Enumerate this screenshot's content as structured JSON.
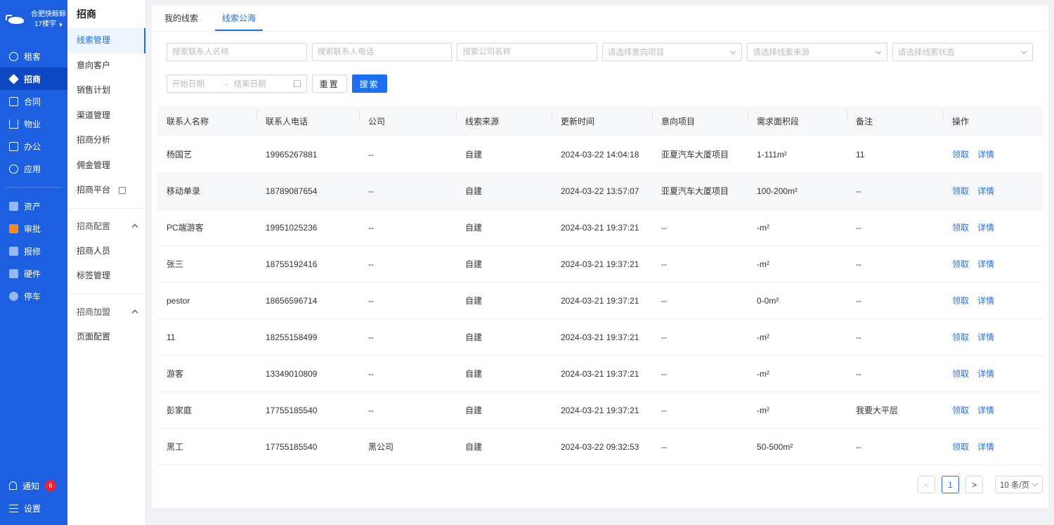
{
  "rail": {
    "brand_line1": "合肥快鲸鲸",
    "brand_line2": "17楼宇",
    "items": [
      {
        "label": "租客",
        "icon": "users-icon"
      },
      {
        "label": "招商",
        "icon": "tag-icon",
        "active": true
      },
      {
        "label": "合同",
        "icon": "document-icon"
      },
      {
        "label": "物业",
        "icon": "house-icon"
      },
      {
        "label": "办公",
        "icon": "monitor-icon"
      },
      {
        "label": "应用",
        "icon": "app-icon"
      }
    ],
    "apps": [
      {
        "label": "资产",
        "icon": "asset-icon"
      },
      {
        "label": "审批",
        "icon": "approval-icon"
      },
      {
        "label": "报修",
        "icon": "repair-icon"
      },
      {
        "label": "硬件",
        "icon": "hardware-icon"
      },
      {
        "label": "停车",
        "icon": "parking-icon"
      }
    ],
    "notify_label": "通知",
    "notify_count": "6",
    "settings_label": "设置"
  },
  "subnav": {
    "title": "招商",
    "items": [
      "线索管理",
      "意向客户",
      "销售计划",
      "渠道管理",
      "招商分析",
      "佣金管理",
      "招商平台"
    ],
    "group1": "招商配置",
    "group1_items": [
      "招商人员",
      "标签管理"
    ],
    "group2": "招商加盟",
    "group2_items": [
      "页面配置"
    ]
  },
  "tabs": [
    "我的线索",
    "线索公海"
  ],
  "filters": {
    "contact_name_ph": "搜索联系人名称",
    "contact_phone_ph": "搜索联系人电话",
    "company_ph": "搜索公司名称",
    "project_ph": "请选择意向项目",
    "source_ph": "请选择线索来源",
    "status_ph": "请选择线索状态",
    "start_date_ph": "开始日期",
    "end_date_ph": "结束日期",
    "reset_label": "重置",
    "search_label": "搜索"
  },
  "table": {
    "headers": [
      "联系人名称",
      "联系人电话",
      "公司",
      "线索来源",
      "更新时间",
      "意向项目",
      "需求面积段",
      "备注",
      "操作"
    ],
    "action_claim": "领取",
    "action_detail": "详情",
    "rows": [
      [
        "杨国艺",
        "19965267881",
        "--",
        "自建",
        "2024-03-22 14:04:18",
        "亚夏汽车大厦项目",
        "1-111m²",
        "11"
      ],
      [
        "移动单录",
        "18789087654",
        "--",
        "自建",
        "2024-03-22 13:57:07",
        "亚夏汽车大厦项目",
        "100-200m²",
        "--"
      ],
      [
        "PC端游客",
        "19951025236",
        "--",
        "自建",
        "2024-03-21 19:37:21",
        "--",
        "-m²",
        "--"
      ],
      [
        "张三",
        "18755192416",
        "--",
        "自建",
        "2024-03-21 19:37:21",
        "--",
        "-m²",
        "--"
      ],
      [
        "pestor",
        "18656596714",
        "--",
        "自建",
        "2024-03-21 19:37:21",
        "--",
        "0-0m²",
        "--"
      ],
      [
        "11",
        "18255158499",
        "--",
        "自建",
        "2024-03-21 19:37:21",
        "--",
        "-m²",
        "--"
      ],
      [
        "游客",
        "13349010809",
        "--",
        "自建",
        "2024-03-21 19:37:21",
        "--",
        "-m²",
        "--"
      ],
      [
        "彭家庭",
        "17755185540",
        "--",
        "自建",
        "2024-03-21 19:37:21",
        "--",
        "-m²",
        "我要大平层"
      ],
      [
        "黑工",
        "17755185540",
        "黑公司",
        "自建",
        "2024-03-22 09:32:53",
        "--",
        "50-500m²",
        "--"
      ]
    ]
  },
  "pagination": {
    "prev": "<",
    "current": "1",
    "next": ">",
    "page_size": "10 条/页"
  }
}
